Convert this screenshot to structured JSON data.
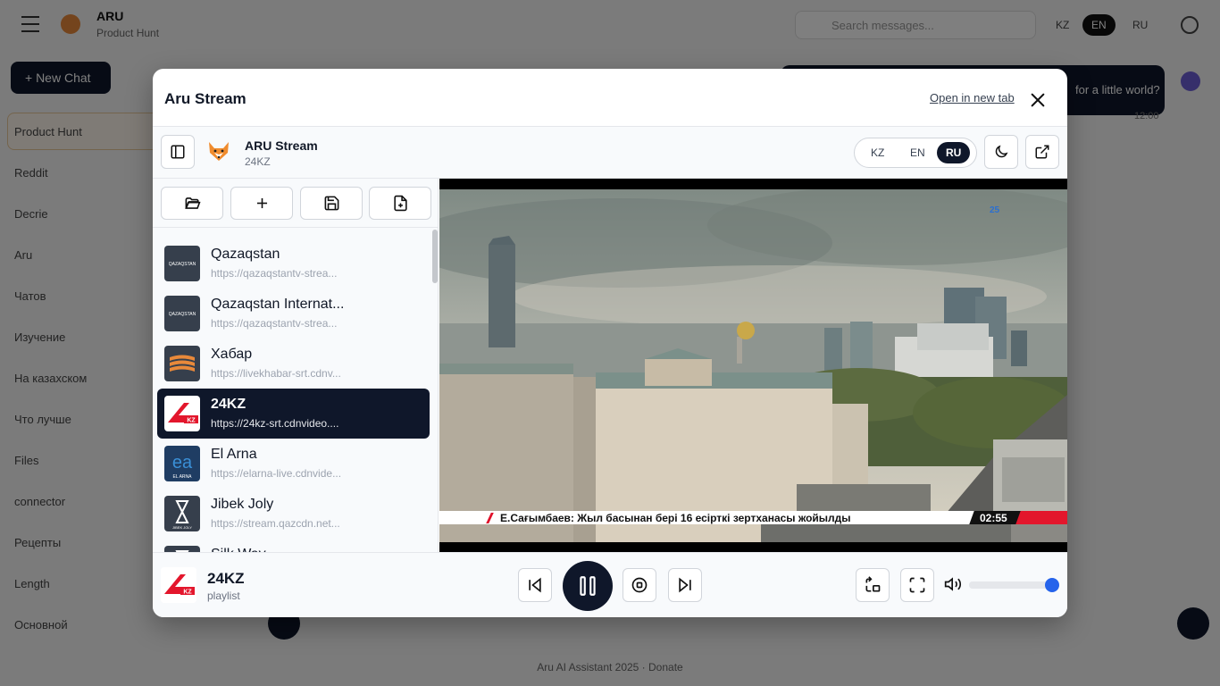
{
  "background": {
    "brand": "ARU",
    "brand_sub": "Product Hunt",
    "search_placeholder": "Search messages...",
    "langs": [
      "KZ",
      "EN",
      "RU"
    ],
    "active_lang": "EN",
    "new_chat": "+ New Chat",
    "sidebar_items": [
      "Product Hunt",
      "Reddit",
      "Decrie",
      "Aru",
      "Чатов",
      "Изучение",
      "На казахском",
      "Что лучше",
      "Files",
      "connector",
      "Рецепты",
      "Length",
      "Основной"
    ],
    "top_button": "for a little world?",
    "time": "12:00",
    "footer": "Aru AI Assistant 2025 · Donate"
  },
  "modal": {
    "title": "Aru Stream",
    "open_new_tab": "Open in new tab"
  },
  "appbar": {
    "name": "ARU Stream",
    "channel": "24KZ",
    "langs": [
      "KZ",
      "EN",
      "RU"
    ],
    "active_lang": "RU"
  },
  "channels": [
    {
      "name": "Qazaqstan",
      "url": "https://qazaqstantv-strea...",
      "logo": "qazaqstan",
      "active": false
    },
    {
      "name": "Qazaqstan Internat...",
      "url": "https://qazaqstantv-strea...",
      "logo": "qazaqstan",
      "active": false
    },
    {
      "name": "Хабар",
      "url": "https://livekhabar-srt.cdnv...",
      "logo": "khabar",
      "active": false
    },
    {
      "name": "24KZ",
      "url": "https://24kz-srt.cdnvideo....",
      "logo": "24kz",
      "active": true
    },
    {
      "name": "El Arna",
      "url": "https://elarna-live.cdnvide...",
      "logo": "elarna",
      "active": false
    },
    {
      "name": "Jibek Joly",
      "url": "https://stream.qazcdn.net...",
      "logo": "jibek",
      "active": false
    },
    {
      "name": "Silk Way",
      "url": "",
      "logo": "jibek",
      "active": false
    }
  ],
  "video": {
    "ticker": "Е.Сағымбаев: Жыл басынан бері 16 есірткі зертханасы жойылды",
    "ticker_time": "02:55",
    "badge": "25"
  },
  "player": {
    "title": "24KZ",
    "subtitle": "playlist",
    "volume": 1.0,
    "accent": "#2563eb"
  },
  "logo_labels": {
    "qazaqstan": "QAZAQSTAN",
    "kz": "KZ",
    "elarna": "EL ARNA",
    "jibek": "JIBEK JOLY"
  }
}
